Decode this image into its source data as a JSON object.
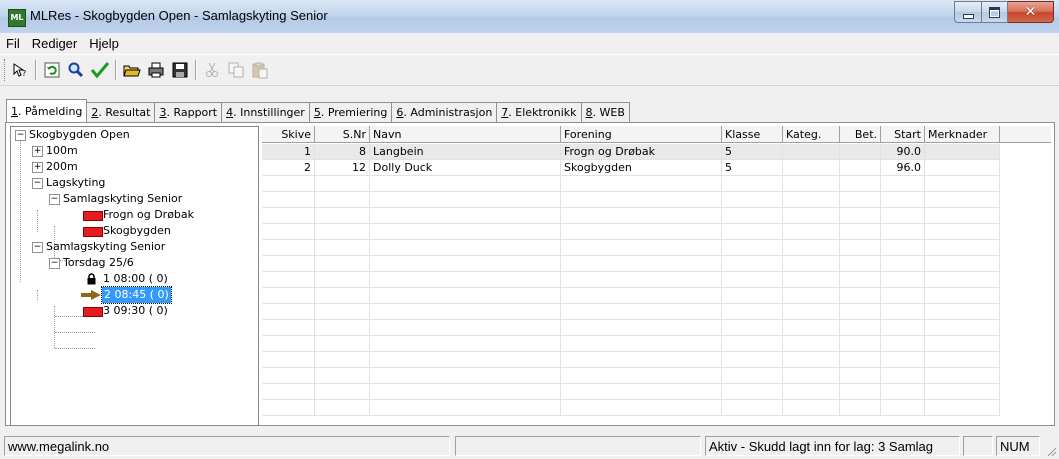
{
  "window": {
    "app_icon_text": "ML",
    "title": "MLRes - Skogbygden Open - Samlagskyting Senior",
    "buttons": {
      "minimize": "minimize",
      "maximize": "maximize",
      "close": "close"
    }
  },
  "menu": [
    "Fil",
    "Rediger",
    "Hjelp"
  ],
  "toolbar": {
    "icons": [
      "help-cursor-icon",
      "refresh-icon",
      "search-icon",
      "check-icon",
      "open-folder-icon",
      "print-icon",
      "save-icon",
      "cut-icon",
      "copy-icon",
      "paste-icon"
    ]
  },
  "tabs": [
    {
      "num": "1",
      "label": ". Påmelding",
      "active": true
    },
    {
      "num": "2",
      "label": ". Resultat",
      "active": false
    },
    {
      "num": "3",
      "label": ". Rapport",
      "active": false
    },
    {
      "num": "4",
      "label": ". Innstillinger",
      "active": false
    },
    {
      "num": "5",
      "label": ". Premiering",
      "active": false
    },
    {
      "num": "6",
      "label": ". Administrasjon",
      "active": false
    },
    {
      "num": "7",
      "label": ". Elektronikk",
      "active": false
    },
    {
      "num": "8",
      "label": ". WEB",
      "active": false
    }
  ],
  "tree": {
    "root": "Skogbygden Open",
    "n100m": "100m",
    "n200m": "200m",
    "lagskyting": "Lagskyting",
    "samlag_senior_1": "Samlagskyting Senior",
    "team1": "Frogn og Drøbak",
    "team2": "Skogbygden",
    "samlag_senior_2": "Samlagskyting Senior",
    "day": "Torsdag 25/6",
    "relay1": "1 08:00  ( 0)",
    "relay2": "2 08:45  ( 0)",
    "relay3": "3 09:30  ( 0)"
  },
  "grid": {
    "headers": [
      "Skive",
      "S.Nr",
      "Navn",
      "Forening",
      "Klasse",
      "Kateg.",
      "Bet.",
      "Start",
      "Merknader"
    ],
    "rows": [
      {
        "skive": "1",
        "snr": "8",
        "navn": "Langbein",
        "forening": "Frogn og Drøbak",
        "klasse": "5",
        "kateg": "",
        "bet": "",
        "start": "90.0",
        "merknader": ""
      },
      {
        "skive": "2",
        "snr": "12",
        "navn": "Dolly Duck",
        "forening": "Skogbygden",
        "klasse": "5",
        "kateg": "",
        "bet": "",
        "start": "96.0",
        "merknader": ""
      }
    ]
  },
  "status": {
    "url": "www.megalink.no",
    "middle": "",
    "message": "Aktiv - Skudd lagt inn for lag: 3 Samlag",
    "blank": "",
    "num": "NUM"
  }
}
